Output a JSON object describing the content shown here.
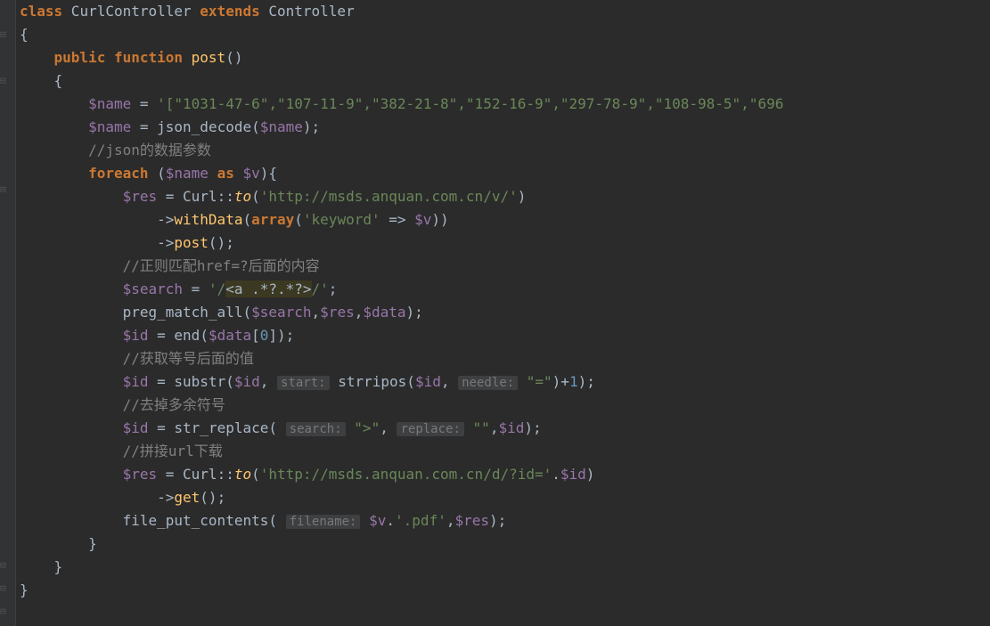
{
  "code": {
    "line1": {
      "kw_class": "class",
      "classname": " CurlController ",
      "kw_extends": "extends",
      "parent": " Controller"
    },
    "line2": "{",
    "line3": {
      "kw_public": "public",
      "kw_function": " function ",
      "method": "post",
      "parens": "()"
    },
    "line4": "{",
    "line5": {
      "var": "$name",
      "eq": " = ",
      "str": "'[\"1031-47-6\",\"107-11-9\",\"382-21-8\",\"152-16-9\",\"297-78-9\",\"108-98-5\",\"696"
    },
    "line6": {
      "var": "$name",
      "eq": " = ",
      "func": "json_decode",
      "open": "(",
      "arg": "$name",
      "close": ");"
    },
    "line7": "//json的数据参数",
    "line8": {
      "kw_foreach": "foreach ",
      "open": "(",
      "var1": "$name",
      "kw_as": " as ",
      "var2": "$v",
      "close": "){"
    },
    "line9": {
      "var": "$res",
      "eq": " = ",
      "class": "Curl",
      "dcolon": "::",
      "method": "to",
      "open": "(",
      "str": "'http://msds.anquan.com.cn/v/'",
      "close": ")"
    },
    "line10": {
      "arrow": "->",
      "method": "withData",
      "open": "(",
      "kw_array": "array",
      "open2": "(",
      "key": "'keyword'",
      "farrow": " => ",
      "var": "$v",
      "close": "))"
    },
    "line11": {
      "arrow": "->",
      "method": "post",
      "parens": "();"
    },
    "line12": "//正则匹配href=?后面的内容",
    "line13": {
      "var": "$search",
      "eq": " = ",
      "str_open": "'/",
      "regex_body": "<a .*?.*?>",
      "str_close": "/'",
      "semi": ";"
    },
    "line14": {
      "func": "preg_match_all",
      "open": "(",
      "a1": "$search",
      "c1": ",",
      "a2": "$res",
      "c2": ",",
      "a3": "$data",
      "close": ");"
    },
    "line15": {
      "var": "$id",
      "eq": " = ",
      "func": "end",
      "open": "(",
      "arg": "$data",
      "bracket": "[",
      "num": "0",
      "bclose": "]",
      "close": ");"
    },
    "line16": "//获取等号后面的值",
    "line17": {
      "var": "$id",
      "eq": " = ",
      "func": "substr",
      "open": "(",
      "a1": "$id",
      "c1": ", ",
      "hint1": "start:",
      "sp1": " ",
      "func2": "strripos",
      "open2": "(",
      "a2": "$id",
      "c2": ", ",
      "hint2": "needle:",
      "sp2": " ",
      "str": "\"=\"",
      "close2": ")+",
      "num": "1",
      "close": ");"
    },
    "line18": "//去掉多余符号",
    "line19": {
      "var": "$id",
      "eq": " = ",
      "func": "str_replace",
      "open": "( ",
      "hint1": "search:",
      "sp1": " ",
      "str1": "\">\"",
      "c1": ", ",
      "hint2": "replace:",
      "sp2": " ",
      "str2": "\"\"",
      "c2": ",",
      "a3": "$id",
      "close": ");"
    },
    "line20": "//拼接url下载",
    "line21": {
      "var": "$res",
      "eq": " = ",
      "class": "Curl",
      "dcolon": "::",
      "method": "to",
      "open": "(",
      "str": "'http://msds.anquan.com.cn/d/?id='",
      "dot": ".",
      "a2": "$id",
      "close": ")"
    },
    "line22": {
      "arrow": "->",
      "method": "get",
      "parens": "();"
    },
    "line23": {
      "func": "file_put_contents",
      "open": "( ",
      "hint": "filename:",
      "sp": " ",
      "a1": "$v",
      "dot": ".",
      "str": "'.pdf'",
      "c1": ",",
      "a2": "$res",
      "close": ");"
    },
    "line24": "}",
    "line25": "}",
    "line26": "}"
  }
}
